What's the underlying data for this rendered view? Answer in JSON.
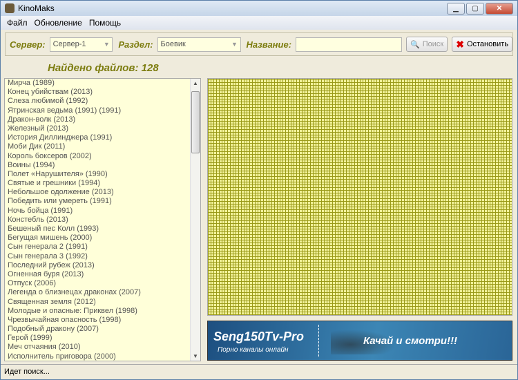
{
  "window": {
    "title": "KinoMaks"
  },
  "menu": [
    "Файл",
    "Обновление",
    "Помощь"
  ],
  "toolbar": {
    "server_label": "Сервер:",
    "server_value": "Сервер-1",
    "section_label": "Раздел:",
    "section_value": "Боевик",
    "name_label": "Название:",
    "name_value": "",
    "search_label": "Поиск",
    "stop_label": "Остановить"
  },
  "found": "Найдено файлов: 128",
  "films": [
    "Мирча (1989)",
    "Конец убийствам (2013)",
    "Слеза любимой (1992)",
    "Ятринская ведьма (1991) (1991)",
    "Дракон-волк (2013)",
    "Железный (2013)",
    "История Диллинджера (1991)",
    "Моби Дик (2011)",
    "Король боксеров (2002)",
    "Воины (1994)",
    "Полет «Нарушителя» (1990)",
    "Святые и грешники (1994)",
    "Небольшое одолжение (2013)",
    "Победить или умереть (1991)",
    "Ночь бойца (1991)",
    "Констебль (2013)",
    "Бешеный пес Колл (1993)",
    "Бегущая мишень (2000)",
    "Сын генерала 2 (1991)",
    "Сын генерала 3 (1992)",
    "Последний рубеж (2013)",
    "Огненная буря (2013)",
    "Отпуск (2006)",
    "Легенда о близнецах драконах (2007)",
    "Священная земля (2012)",
    "Молодые и опасные: Приквел (1998)",
    "Чрезвычайная опасность (1998)",
    "Подобный дракону (2007)",
    "Герой (1999)",
    "Меч отчаяния (2010)",
    "Исполнитель приговора (2000)"
  ],
  "banner": {
    "brand": "Seng150Tv-Pro",
    "subtitle": "Порно каналы онлайн",
    "cta": "Качай и смотри!!!"
  },
  "status": "Идет поиск..."
}
